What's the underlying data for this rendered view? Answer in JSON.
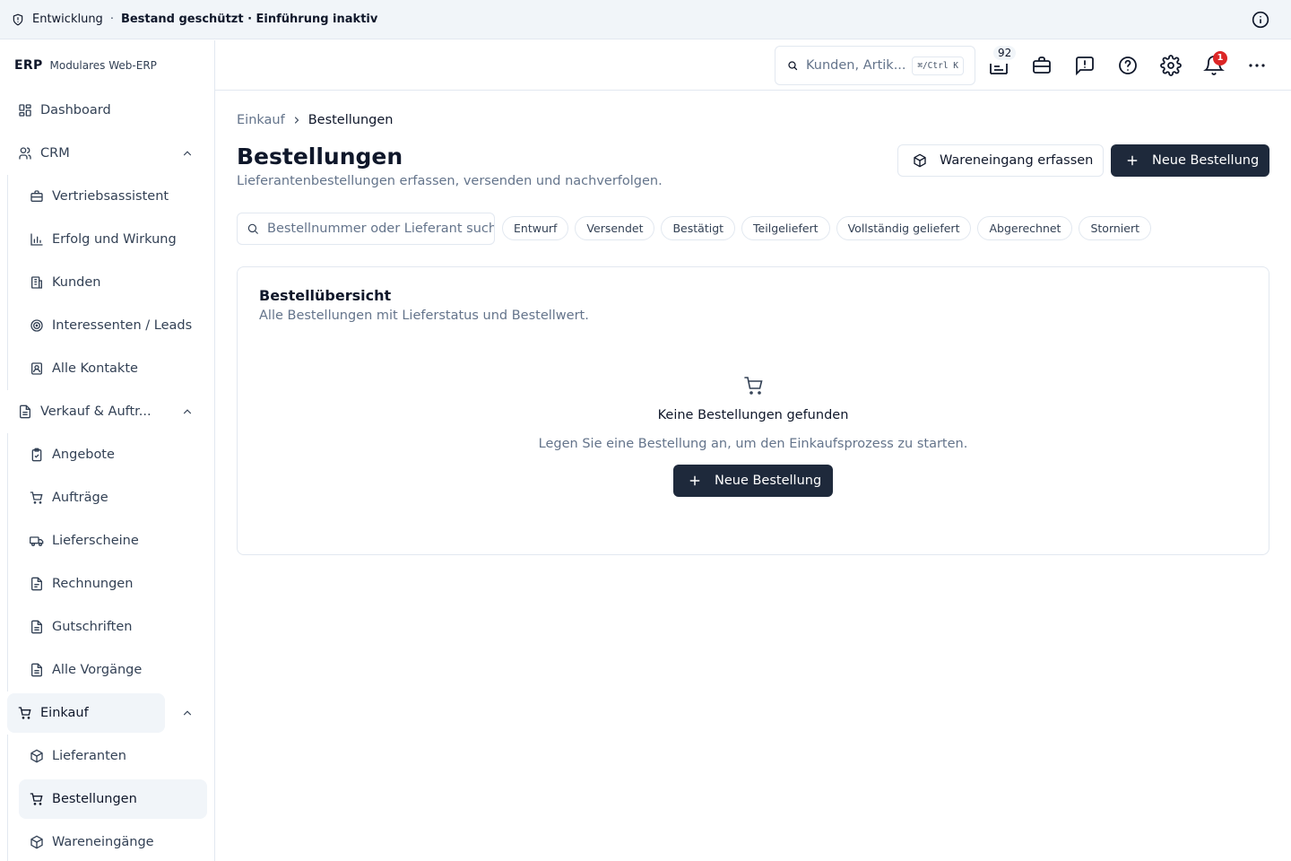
{
  "env": {
    "environment": "Entwicklung",
    "separator": "·",
    "status": "Bestand geschützt · Einführung inaktiv"
  },
  "brand": {
    "logo": "ERP",
    "subtitle": "Modulares Web-ERP"
  },
  "sidebar": {
    "dashboard": "Dashboard",
    "crm": {
      "label": "CRM",
      "items": [
        "Vertriebsassistent",
        "Erfolg und Wirkung",
        "Kunden",
        "Interessenten / Leads",
        "Alle Kontakte"
      ]
    },
    "sales": {
      "label": "Verkauf & Auftr...",
      "items": [
        "Angebote",
        "Aufträge",
        "Lieferscheine",
        "Rechnungen",
        "Gutschriften",
        "Alle Vorgänge"
      ]
    },
    "purchasing": {
      "label": "Einkauf",
      "items": [
        "Lieferanten",
        "Bestellungen",
        "Wareneingänge"
      ],
      "active_item": "Bestellungen"
    }
  },
  "header": {
    "search_placeholder": "Kunden, Artik...",
    "shortcut": "⌘/Ctrl K",
    "inventory_count": "92",
    "notification_count": "1"
  },
  "breadcrumb": {
    "parent": "Einkauf",
    "current": "Bestellungen"
  },
  "page": {
    "title": "Bestellungen",
    "subtitle": "Lieferantenbestellungen erfassen, versenden und nachverfolgen.",
    "goods_receipt_button": "Wareneingang erfassen",
    "new_order_button": "Neue Bestellung"
  },
  "filters": {
    "search_placeholder": "Bestellnummer oder Lieferant suchen",
    "statuses": [
      "Entwurf",
      "Versendet",
      "Bestätigt",
      "Teilgeliefert",
      "Vollständig geliefert",
      "Abgerechnet",
      "Storniert"
    ]
  },
  "card": {
    "title": "Bestellübersicht",
    "description": "Alle Bestellungen mit Lieferstatus und Bestellwert.",
    "empty_title": "Keine Bestellungen gefunden",
    "empty_description": "Legen Sie eine Bestellung an, um den Einkaufsprozess zu starten.",
    "empty_button": "Neue Bestellung"
  },
  "colors": {
    "primary": "#1e293b",
    "border": "#e2e8f0",
    "muted_text": "#64748b",
    "notification": "#dc2626",
    "env_bar": "#f1f5f9"
  }
}
